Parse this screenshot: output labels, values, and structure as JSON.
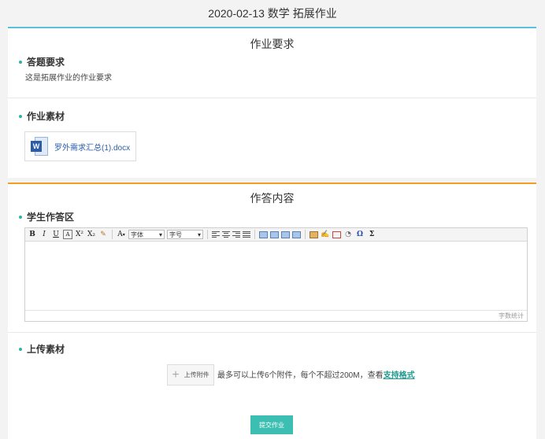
{
  "header": {
    "title": "2020-02-13 数学 拓展作业"
  },
  "requirements": {
    "section_title": "作业要求",
    "answer_req_label": "答题要求",
    "answer_req_text": "这是拓展作业的作业要求",
    "materials_label": "作业素材",
    "file": {
      "name": "罗外需求汇总(1).docx",
      "icon": "word-doc-icon",
      "icon_letter": "W"
    }
  },
  "answer": {
    "section_title": "作答内容",
    "student_area_label": "学生作答区",
    "editor": {
      "font_placeholder": "字体",
      "size_placeholder": "字号",
      "word_count_label": "字数统计",
      "buttons": {
        "bold": "B",
        "italic": "I",
        "underline": "U",
        "border": "A",
        "superscript": "X²",
        "subscript": "X₂",
        "font_color": "A",
        "omega": "Ω",
        "sigma": "Σ"
      }
    },
    "upload_label": "上传素材",
    "upload_button": "上传附件",
    "upload_hint": "最多可以上传6个附件，每个不超过200M，查看",
    "supported_formats_link": "支持格式",
    "submit_button": "提交作业"
  },
  "colors": {
    "req_accent": "#5bc0de",
    "ans_accent": "#f0a020",
    "teal": "#3cbfb2"
  }
}
